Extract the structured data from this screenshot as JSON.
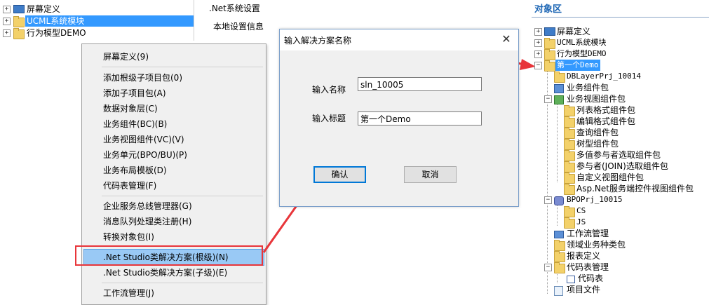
{
  "left_tree": {
    "items": [
      {
        "label": "屏幕定义",
        "icon": "screen-icon"
      },
      {
        "label": "UCML系统模块",
        "icon": "folder-icon",
        "selected": true
      },
      {
        "label": "行为模型DEMO",
        "icon": "behavior-icon"
      }
    ]
  },
  "settings": {
    "tab1": ".Net系统设置",
    "tab2": "本地设置信息"
  },
  "context_menu": {
    "items": [
      "屏幕定义(9)",
      "添加根级子项目包(0)",
      "添加子项目包(A)",
      "数据对象层(C)",
      "业务组件(BC)(B)",
      "业务视图组件(VC)(V)",
      "业务单元(BPO/BU)(P)",
      "业务布局模板(D)",
      "代码表管理(F)",
      "企业服务总线管理器(G)",
      "消息队列处理类注册(H)",
      "转换对象包(I)",
      ".Net Studio类解决方案(根级)(N)",
      ".Net Studio类解决方案(子级)(E)",
      "工作流管理(J)"
    ],
    "highlighted_index": 12
  },
  "dialog": {
    "title": "输入解决方案名称",
    "close": "✕",
    "name_label": "输入名称",
    "name_value": "sln_10005",
    "title_label": "输入标题",
    "title_value": "第一个Demo",
    "ok": "确认",
    "cancel": "取消"
  },
  "right_panel": {
    "title": "对象区",
    "tree": [
      {
        "label": "屏幕定义"
      },
      {
        "label": "UCML系统模块"
      },
      {
        "label": "行为模型DEMO"
      },
      {
        "label": "第一个Demo",
        "selected": true
      },
      {
        "label": "DBLayerPrj_10014"
      },
      {
        "label": "业务组件包"
      },
      {
        "label": "业务视图组件包"
      },
      {
        "label": "列表格式组件包"
      },
      {
        "label": "编辑格式组件包"
      },
      {
        "label": "查询组件包"
      },
      {
        "label": "树型组件包"
      },
      {
        "label": "多值参与者选取组件包"
      },
      {
        "label": "参与者(JOIN)选取组件包"
      },
      {
        "label": "自定义视图组件包"
      },
      {
        "label": "Asp.Net服务端控件视图组件包"
      },
      {
        "label": "BPOPrj_10015"
      },
      {
        "label": "CS"
      },
      {
        "label": "JS"
      },
      {
        "label": "工作流管理"
      },
      {
        "label": "领域业务种类包"
      },
      {
        "label": "报表定义"
      },
      {
        "label": "代码表管理"
      },
      {
        "label": "代码表"
      },
      {
        "label": "项目文件"
      }
    ]
  },
  "colors": {
    "selection": "#3399ff",
    "menu_highlight": "#99c9f5",
    "annotation_red": "#e8353a",
    "panel_title": "#1e67b5"
  }
}
